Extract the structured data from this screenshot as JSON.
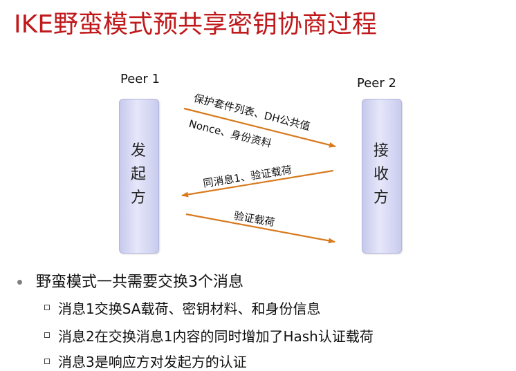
{
  "title": "IKE野蛮模式预共享密钥协商过程",
  "diagram": {
    "peer1": {
      "label": "Peer 1",
      "role_chars": [
        "发",
        "起",
        "方"
      ]
    },
    "peer2": {
      "label": "Peer 2",
      "role_chars": [
        "接",
        "收",
        "方"
      ]
    },
    "messages": [
      {
        "line1": "保护套件列表、DH公共值",
        "line2": "Nonce、身份资料",
        "direction": "peer1-to-peer2"
      },
      {
        "line1": "同消息1、验证载荷",
        "direction": "peer2-to-peer1"
      },
      {
        "line1": "验证载荷",
        "direction": "peer1-to-peer2"
      }
    ],
    "arrow_color": "#d87a1e"
  },
  "bullets": {
    "main": "野蛮模式一共需要交换3个消息",
    "subs": [
      "消息1交换SA载荷、密钥材料、和身份信息",
      "消息2在交换消息1内容的同时增加了Hash认证载荷",
      "消息3是响应方对发起方的认证"
    ]
  }
}
